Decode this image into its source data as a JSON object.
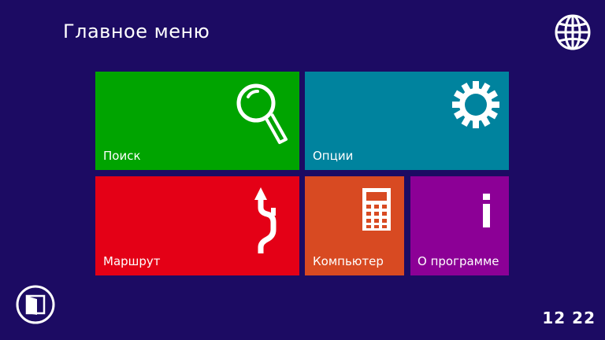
{
  "header": {
    "title": "Главное меню"
  },
  "tiles": {
    "search": {
      "label": "Поиск",
      "color": "#00a400",
      "icon": "magnifier-icon"
    },
    "options": {
      "label": "Опции",
      "color": "#00839e",
      "icon": "gear-icon"
    },
    "route": {
      "label": "Маршрут",
      "color": "#e40016",
      "icon": "route-arrow-icon"
    },
    "computer": {
      "label": "Компьютер",
      "color": "#d84a22",
      "icon": "calculator-icon"
    },
    "about": {
      "label": "О программе",
      "color": "#8c0096",
      "icon": "info-icon"
    }
  },
  "footer": {
    "clock": "12 22",
    "exit_icon": "door-exit-icon",
    "language_icon": "globe-icon"
  },
  "colors": {
    "background": "#1c0b63",
    "foreground": "#ffffff"
  }
}
